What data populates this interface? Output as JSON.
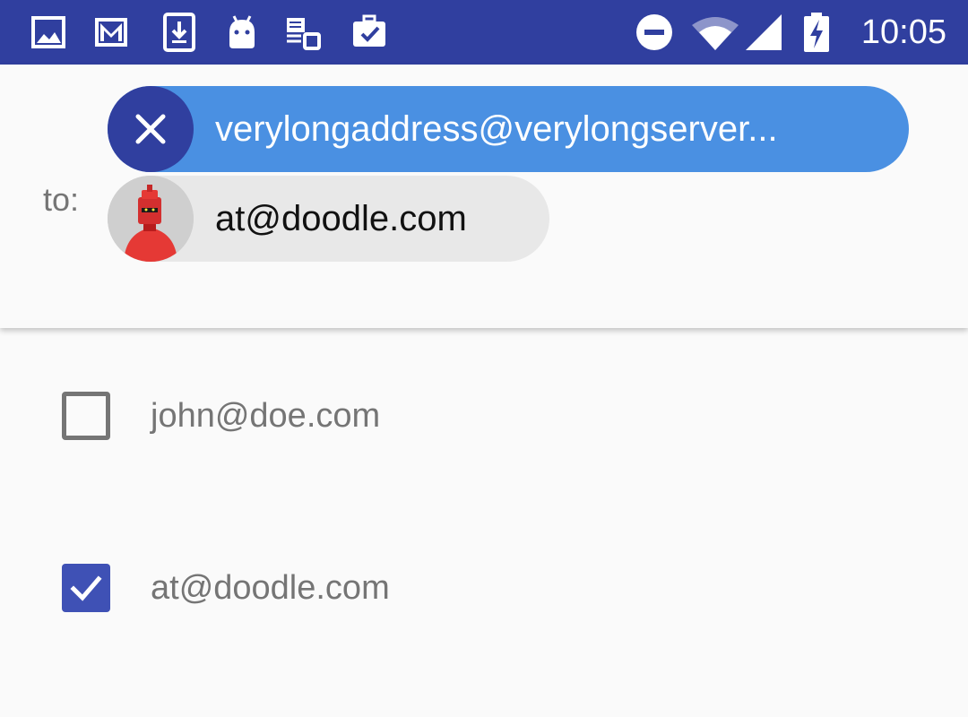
{
  "status_bar": {
    "time": "10:05",
    "left_icons": [
      "image-icon",
      "gmail-icon",
      "download-icon",
      "android-icon",
      "layers-icon",
      "work-icon"
    ],
    "right_icons": [
      "do-not-disturb-icon",
      "wifi-icon",
      "signal-icon",
      "battery-charging-icon"
    ]
  },
  "recipients": {
    "to_label": "to:",
    "chips": [
      {
        "text": "verylongaddress@verylongserver...",
        "selected": true,
        "lead": "close-icon"
      },
      {
        "text": "at@doodle.com",
        "selected": false,
        "lead": "avatar"
      }
    ]
  },
  "contacts": [
    {
      "email": "john@doe.com",
      "checked": false
    },
    {
      "email": "at@doodle.com",
      "checked": true
    }
  ],
  "colors": {
    "status_bar": "#303f9f",
    "chip_selected": "#4a90e2",
    "chip_close": "#303f9f",
    "chip_normal": "#e8e8e8",
    "checkbox_checked": "#3f51b5"
  }
}
